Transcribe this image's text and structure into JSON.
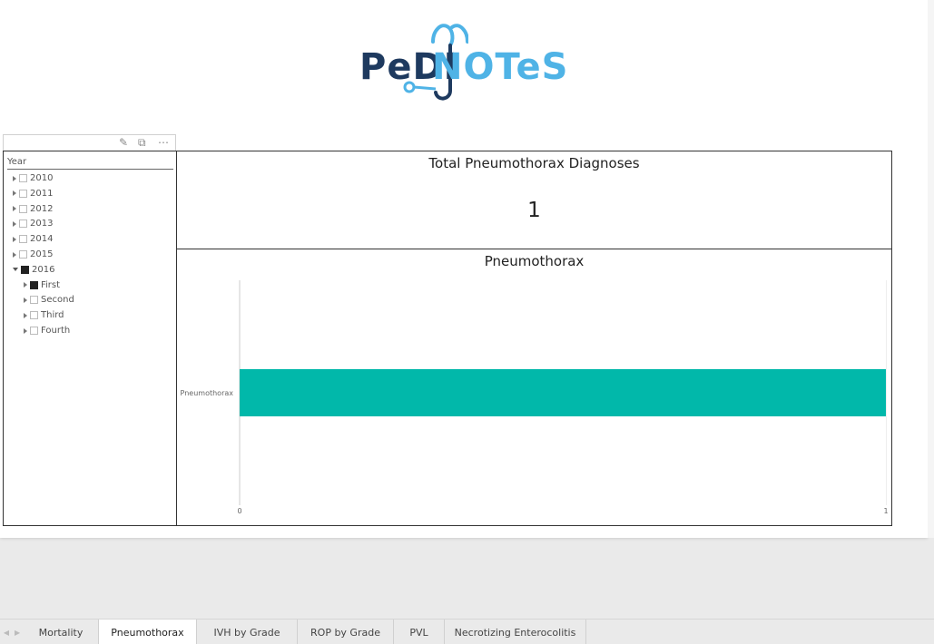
{
  "logo": {
    "part1": "PeDI",
    "part2": "NOTeS",
    "alt": "PEDINOTES"
  },
  "slicer": {
    "header": "Year",
    "items": [
      {
        "label": "2010",
        "checked": false,
        "expanded": false,
        "level": 0
      },
      {
        "label": "2011",
        "checked": false,
        "expanded": false,
        "level": 0
      },
      {
        "label": "2012",
        "checked": false,
        "expanded": false,
        "level": 0
      },
      {
        "label": "2013",
        "checked": false,
        "expanded": false,
        "level": 0
      },
      {
        "label": "2014",
        "checked": false,
        "expanded": false,
        "level": 0
      },
      {
        "label": "2015",
        "checked": false,
        "expanded": false,
        "level": 0
      },
      {
        "label": "2016",
        "checked": true,
        "expanded": true,
        "level": 0
      },
      {
        "label": "First",
        "checked": true,
        "expanded": false,
        "level": 1
      },
      {
        "label": "Second",
        "checked": false,
        "expanded": false,
        "level": 1
      },
      {
        "label": "Third",
        "checked": false,
        "expanded": false,
        "level": 1
      },
      {
        "label": "Fourth",
        "checked": false,
        "expanded": false,
        "level": 1
      }
    ]
  },
  "card": {
    "title": "Total Pneumothorax Diagnoses",
    "value": "1"
  },
  "chart_data": {
    "type": "bar",
    "orientation": "horizontal",
    "title": "Pneumothorax",
    "categories": [
      "Pneumothorax"
    ],
    "values": [
      1
    ],
    "xlim": [
      0,
      1
    ],
    "x_ticks": [
      "0",
      "1"
    ],
    "bar_color": "#01b8aa",
    "grid": false
  },
  "tabs": [
    {
      "label": "Mortality",
      "active": false
    },
    {
      "label": "Pneumothorax",
      "active": true
    },
    {
      "label": "IVH by Grade",
      "active": false
    },
    {
      "label": "ROP by Grade",
      "active": false
    },
    {
      "label": "PVL",
      "active": false
    },
    {
      "label": "Necrotizing Enterocolitis",
      "active": false
    }
  ],
  "colors": {
    "brand_dark": "#1e3a5f",
    "brand_light": "#4fb3e6",
    "bar": "#01b8aa"
  }
}
